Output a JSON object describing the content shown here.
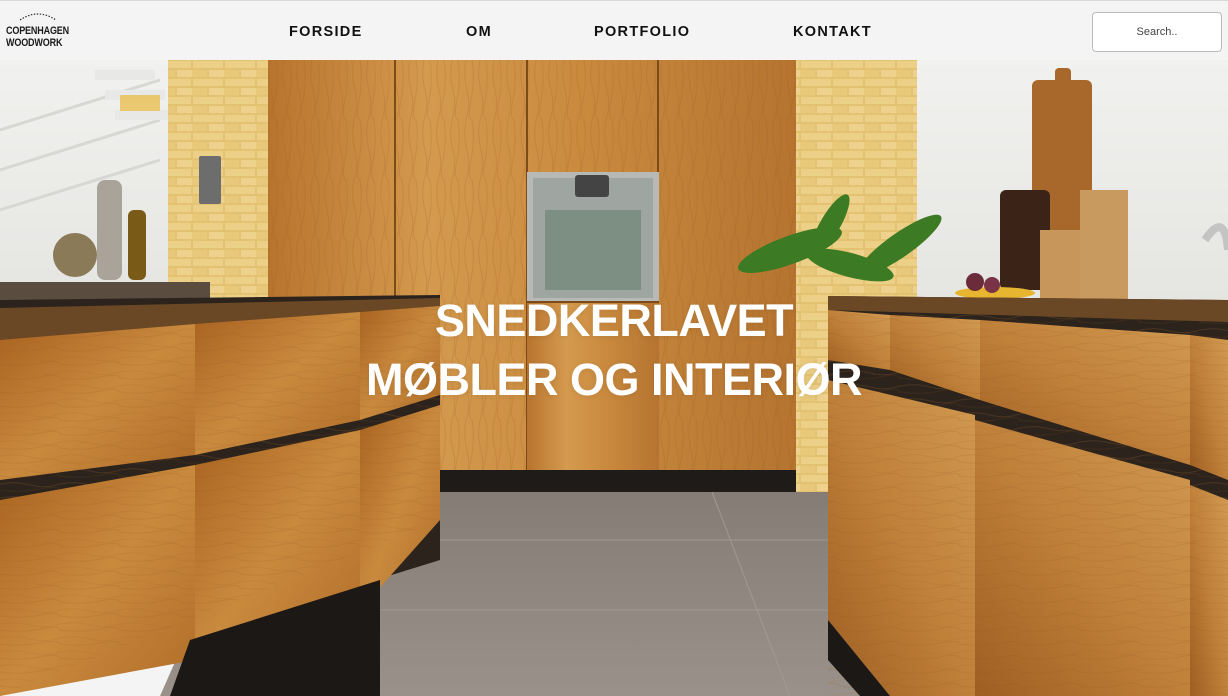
{
  "brand": {
    "line1": "COPENHAGEN",
    "line2": "WOODWORK",
    "arc_text": "MADE TOGETHER"
  },
  "nav": {
    "items": [
      {
        "label": "FORSIDE"
      },
      {
        "label": "OM"
      },
      {
        "label": "PORTFOLIO"
      },
      {
        "label": "KONTAKT"
      }
    ]
  },
  "search": {
    "placeholder": "Search.."
  },
  "hero": {
    "title_line1": "SNEDKERLAVET",
    "title_line2": "MØBLER OG INTERIØR"
  },
  "colors": {
    "header_bg": "#f4f4f4",
    "oak": "#c98a3e",
    "oak_dark": "#9c5f22",
    "brick": "#e2c071",
    "floor": "#8f8880",
    "hero_text": "#ffffff"
  }
}
